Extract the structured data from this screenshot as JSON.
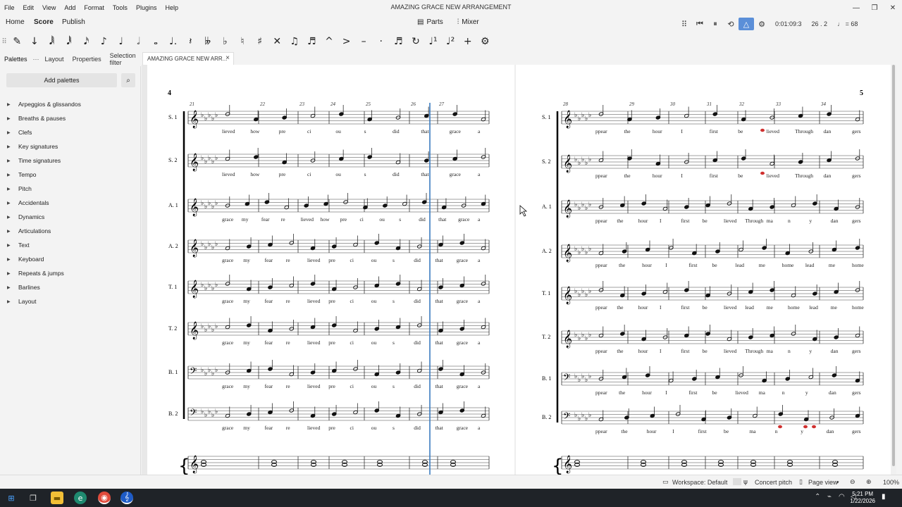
{
  "app": {
    "title": "AMAZING GRACE NEW ARRANGEMENT",
    "menu": [
      "File",
      "Edit",
      "View",
      "Add",
      "Format",
      "Tools",
      "Plugins",
      "Help"
    ]
  },
  "main_tabs": [
    "Home",
    "Score",
    "Publish"
  ],
  "center_tools": {
    "parts": "Parts",
    "mixer": "Mixer"
  },
  "playback": {
    "time": "0:01:09:3",
    "position": "26 . 2",
    "tempo": "♩ = 68"
  },
  "panel_tabs": [
    "Palettes",
    "Layout",
    "Properties",
    "Selection filter"
  ],
  "document_tab": "AMAZING GRACE NEW ARR...",
  "palettes": {
    "add_button": "Add palettes",
    "items": [
      "Arpeggios & glissandos",
      "Breaths & pauses",
      "Clefs",
      "Key signatures",
      "Time signatures",
      "Tempo",
      "Pitch",
      "Accidentals",
      "Dynamics",
      "Articulations",
      "Text",
      "Keyboard",
      "Repeats & jumps",
      "Barlines",
      "Layout"
    ]
  },
  "score": {
    "page_left": "4",
    "page_right": "5",
    "staves": [
      "S. 1",
      "S. 2",
      "A. 1",
      "A. 2",
      "T. 1",
      "T. 2",
      "B. 1",
      "B. 2"
    ],
    "left_measures": [
      "21",
      "22",
      "23",
      "24",
      "25",
      "26",
      "27"
    ],
    "right_measures": [
      "28",
      "29",
      "30",
      "31",
      "32",
      "33",
      "34"
    ],
    "left_lyrics": [
      [
        "lieved",
        "how",
        "pre",
        "ci",
        "ou",
        "s",
        "did",
        "that",
        "grace",
        "a"
      ],
      [
        "lieved",
        "how",
        "pre",
        "ci",
        "ou",
        "s",
        "did",
        "that",
        "grace",
        "a"
      ],
      [
        "grace",
        "my",
        "fear",
        "re",
        "lieved",
        "how",
        "pre",
        "ci",
        "ou",
        "s",
        "did",
        "that",
        "grace",
        "a"
      ],
      [
        "grace",
        "my",
        "fear",
        "re",
        "lieved",
        "pre",
        "ci",
        "ou",
        "s",
        "did",
        "that",
        "grace",
        "a"
      ],
      [
        "grace",
        "my",
        "fear",
        "re",
        "lieved",
        "pre",
        "ci",
        "ou",
        "s",
        "did",
        "that",
        "grace",
        "a"
      ],
      [
        "grace",
        "my",
        "fear",
        "re",
        "lieved",
        "pre",
        "ci",
        "ou",
        "s",
        "did",
        "that",
        "grace",
        "a"
      ],
      [
        "grace",
        "my",
        "fear",
        "re",
        "lieved",
        "pre",
        "ci",
        "ou",
        "s",
        "did",
        "that",
        "grace",
        "a"
      ],
      [
        "grace",
        "my",
        "fear",
        "re",
        "lieved",
        "pre",
        "ci",
        "ou",
        "s",
        "did",
        "that",
        "grace",
        "a"
      ]
    ],
    "right_lyrics": [
      [
        "ppear",
        "the",
        "hour",
        "I",
        "first",
        "be",
        "lieved",
        "Through",
        "dan",
        "gers"
      ],
      [
        "ppear",
        "the",
        "hour",
        "I",
        "first",
        "be",
        "lieved",
        "Through",
        "dan",
        "gers"
      ],
      [
        "ppear",
        "the",
        "hour",
        "I",
        "first",
        "be",
        "lieved",
        "Through",
        "ma",
        "n",
        "y",
        "dan",
        "gers"
      ],
      [
        "ppear",
        "the",
        "hour",
        "I",
        "first",
        "be",
        "lead",
        "me",
        "home",
        "lead",
        "me",
        "home"
      ],
      [
        "ppear",
        "the",
        "hour",
        "I",
        "first",
        "be",
        "lieved",
        "lead",
        "me",
        "home",
        "lead",
        "me",
        "home"
      ],
      [
        "ppear",
        "the",
        "hour",
        "I",
        "first",
        "be",
        "lieved",
        "Through",
        "ma",
        "n",
        "y",
        "dan",
        "gers"
      ],
      [
        "ppear",
        "the",
        "hour",
        "I",
        "first",
        "be",
        "lieved",
        "ma",
        "n",
        "y",
        "dan",
        "gers"
      ],
      [
        "ppear",
        "the",
        "hour",
        "I",
        "first",
        "be",
        "ma",
        "n",
        "y",
        "dan",
        "gers"
      ]
    ]
  },
  "status": {
    "workspace": "Workspace: Default",
    "concert_pitch": "Concert pitch",
    "page_view": "Page view",
    "zoom": "100%"
  },
  "taskbar": {
    "time": "5:21 PM",
    "date": "1/22/2026"
  },
  "colors": {
    "accent": "#5b8fd8",
    "playback_cursor": "#3a7bbf",
    "out_of_range": "#d0302f"
  }
}
